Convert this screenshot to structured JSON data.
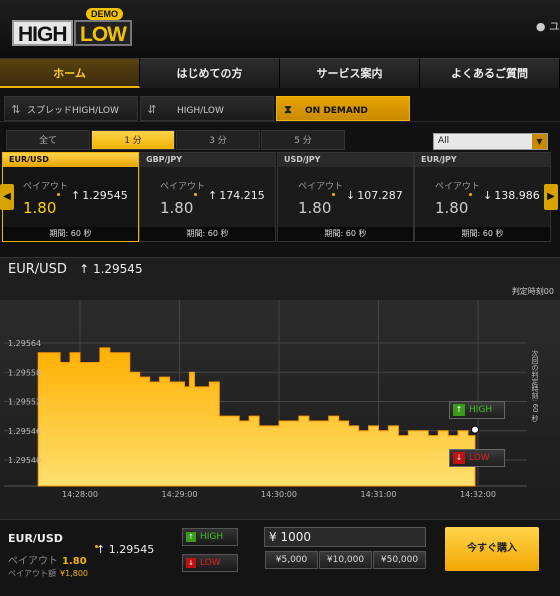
{
  "header": {
    "demo_label": "DEMO",
    "logo_high": "HIGH",
    "logo_low": "LOW",
    "user_text": "ユ"
  },
  "main_nav": [
    "ホーム",
    "はじめての方",
    "サービス案内",
    "よくあるご質問"
  ],
  "option_types": [
    {
      "label": "スプレッドHIGH/LOW",
      "icon": "spread-arrows-icon"
    },
    {
      "label": "HIGH/LOW",
      "icon": "updown-arrows-icon"
    },
    {
      "label": "ON DEMAND",
      "icon": "hourglass-icon",
      "active": true
    }
  ],
  "durations": [
    "全て",
    "1 分",
    "3 分",
    "5 分"
  ],
  "duration_active": 1,
  "filter_select": "All",
  "cards": [
    {
      "pair": "EUR/USD",
      "payout_label": "ペイアウト",
      "payout": "1.80",
      "direction": "up",
      "rate": "1.29545",
      "period": "期間: 60 秒"
    },
    {
      "pair": "GBP/JPY",
      "payout_label": "ペイアウト",
      "payout": "1.80",
      "direction": "up",
      "rate": "174.215",
      "period": "期間: 60 秒"
    },
    {
      "pair": "USD/JPY",
      "payout_label": "ペイアウト",
      "payout": "1.80",
      "direction": "down",
      "rate": "107.287",
      "period": "期間: 60 秒"
    },
    {
      "pair": "EUR/JPY",
      "payout_label": "ペイアウト",
      "payout": "1.80",
      "direction": "down",
      "rate": "138.986",
      "period": "期間: 60 秒"
    }
  ],
  "chart_panel": {
    "pair": "EUR/USD",
    "rate_arrow": "↑",
    "rate": "1.29545",
    "judge_label": "判定時刻00",
    "vertical_note": "次回の判定時刻: 60 秒",
    "high_label": "HIGH",
    "low_label": "LOW"
  },
  "chart_data": {
    "type": "area",
    "x_ticks": [
      "14:28:00",
      "14:29:00",
      "14:30:00",
      "14:31:00",
      "14:32:00"
    ],
    "y_ticks": [
      "1.29564",
      "1.29558",
      "1.29552",
      "1.29546",
      "1.29540"
    ],
    "y_tick_values": [
      1.29564,
      1.29558,
      1.29552,
      1.29546,
      1.2954
    ],
    "x_tick_minutes": [
      0,
      1,
      2,
      3,
      4
    ],
    "ylim": [
      1.29535,
      1.29568
    ],
    "xlim": [
      -0.42,
      4.02
    ],
    "series": [
      {
        "x": [
          -0.42,
          -0.3,
          -0.2,
          -0.1,
          0.0,
          0.1,
          0.2,
          0.25,
          0.3,
          0.4,
          0.5,
          0.55,
          0.6,
          0.7,
          0.8,
          0.9,
          0.95,
          1.0,
          1.05,
          1.1,
          1.15,
          1.2,
          1.3,
          1.38,
          1.4,
          1.5,
          1.6,
          1.7,
          1.8,
          1.9,
          2.0,
          2.1,
          2.2,
          2.3,
          2.4,
          2.5,
          2.6,
          2.7,
          2.8,
          2.9,
          3.0,
          3.1,
          3.2,
          3.3,
          3.4,
          3.5,
          3.6,
          3.7,
          3.8,
          3.9,
          3.97
        ],
        "y": [
          1.29562,
          1.29562,
          1.2956,
          1.29562,
          1.2956,
          1.2956,
          1.29563,
          1.29563,
          1.29562,
          1.29562,
          1.29558,
          1.29558,
          1.29557,
          1.29556,
          1.29557,
          1.29556,
          1.29556,
          1.29556,
          1.29555,
          1.29558,
          1.29555,
          1.29555,
          1.29556,
          1.29556,
          1.29549,
          1.29549,
          1.29548,
          1.29549,
          1.29547,
          1.29547,
          1.29548,
          1.29548,
          1.29549,
          1.29548,
          1.29548,
          1.29549,
          1.29548,
          1.29547,
          1.29546,
          1.29547,
          1.29546,
          1.29547,
          1.29545,
          1.29546,
          1.29546,
          1.29545,
          1.29546,
          1.29545,
          1.29546,
          1.29545,
          1.29545
        ]
      }
    ]
  },
  "trade": {
    "pair": "EUR/USD",
    "payout_label": "ペイアウト",
    "payout": "1.80",
    "payout_amount_label": "ペイアウト額",
    "payout_amount": "¥1,800",
    "rate_arrow": "↑",
    "rate": "1.29545",
    "high_label": "HIGH",
    "low_label": "LOW",
    "amount": "¥ 1000",
    "quick_amounts": [
      "¥5,000",
      "¥10,000",
      "¥50,000"
    ],
    "buy_label": "今すぐ購入"
  },
  "colors": {
    "accent": "#f2b400",
    "area_top": "#ffb000",
    "area_bottom": "#ffe070",
    "up_green": "#3a9a1a",
    "down_red": "#c01010"
  }
}
